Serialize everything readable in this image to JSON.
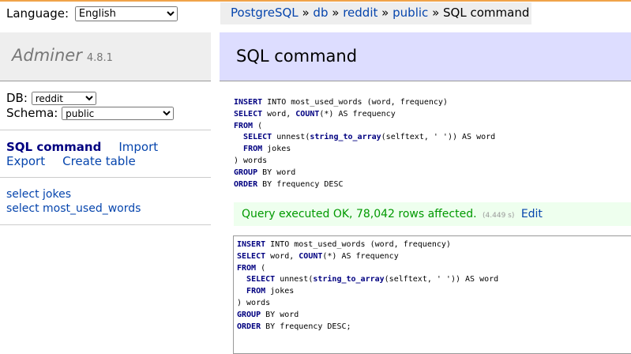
{
  "menu": {
    "language_label": "Language:",
    "language_value": "English",
    "app_name": "Adminer",
    "version": "4.8.1",
    "db_label": "DB:",
    "db_value": "reddit",
    "schema_label": "Schema:",
    "schema_value": "public",
    "links": [
      "SQL command",
      "Import",
      "Export",
      "Create table"
    ],
    "tables": [
      "select jokes",
      "select most_used_words"
    ]
  },
  "breadcrumb": {
    "items": [
      "PostgreSQL",
      "db",
      "reddit",
      "public"
    ],
    "separator": "»",
    "current": "SQL command"
  },
  "page_title": "SQL command",
  "executed_query": {
    "lines": [
      "INSERT INTO most_used_words (word, frequency)",
      "SELECT word, COUNT(*) AS frequency",
      "FROM (",
      "  SELECT unnest(string_to_array(selftext, ' ')) AS word",
      "  FROM jokes",
      ") words",
      "GROUP BY word",
      "ORDER BY frequency DESC"
    ]
  },
  "message": {
    "text": "Query executed OK, 78,042 rows affected.",
    "time": "(4.449 s)",
    "edit_label": "Edit"
  },
  "editor": {
    "lines": [
      "INSERT INTO most_used_words (word, frequency)",
      "SELECT word, COUNT(*) AS frequency",
      "FROM (",
      "  SELECT unnest(string_to_array(selftext, ' ')) AS word",
      "  FROM jokes",
      ") words",
      "GROUP BY word",
      "ORDER BY frequency DESC;"
    ]
  },
  "colors": {
    "accent_top": "#f0a34a",
    "header_bg": "#ddf",
    "success_bg": "#efe",
    "success_text": "#009900",
    "link": "#0645ad"
  }
}
